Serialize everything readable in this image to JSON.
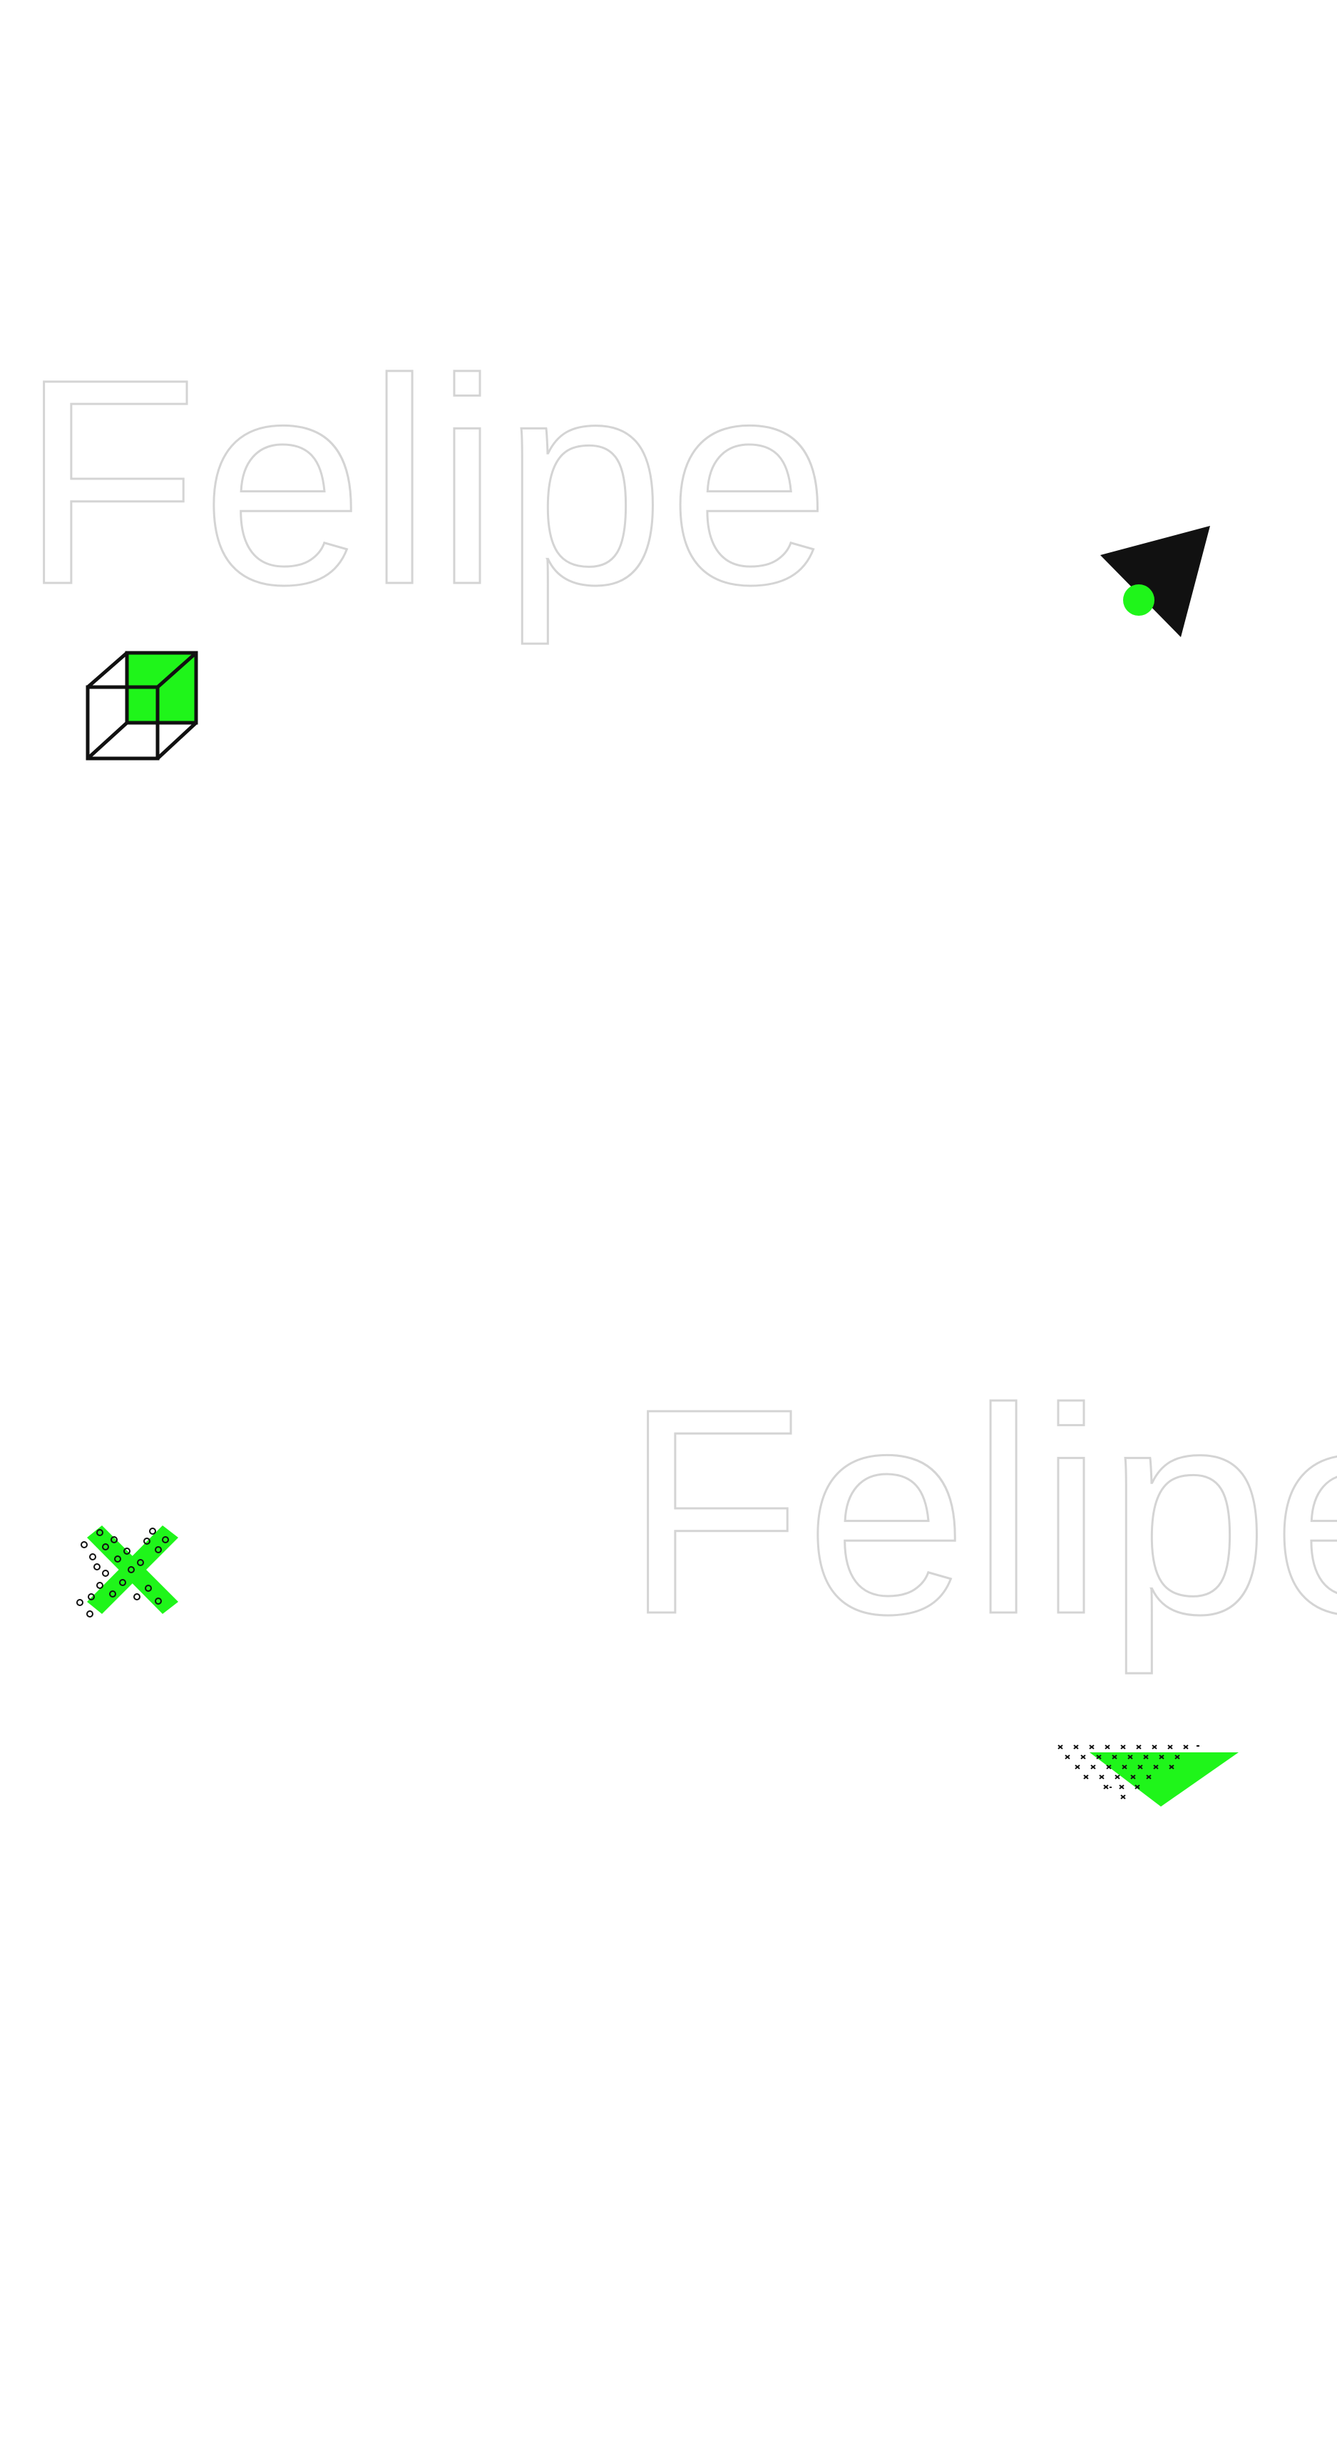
{
  "watermarks": [
    {
      "text": "Felipe"
    },
    {
      "text": "Felipe"
    }
  ],
  "colors": {
    "accent": "#1ff51a",
    "ink": "#111111",
    "outline_text": "#d4d4d4",
    "background": "#ffffff"
  },
  "graphics": [
    {
      "name": "wireframe-cube-icon"
    },
    {
      "name": "arrow-cursor-icon"
    },
    {
      "name": "cross-x-icon"
    },
    {
      "name": "triangle-halftone-icon"
    }
  ]
}
